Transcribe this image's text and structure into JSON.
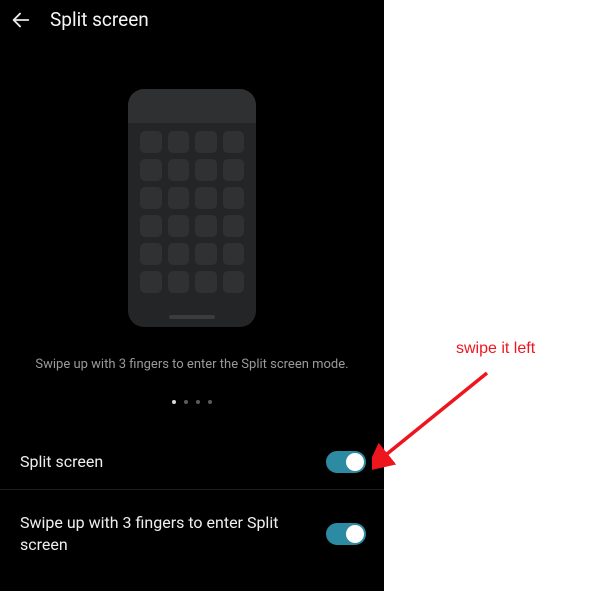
{
  "header": {
    "title": "Split screen"
  },
  "hint": "Swipe up with 3 fingers to enter the Split screen mode.",
  "pager": {
    "count": 4,
    "active": 0
  },
  "settings": {
    "row1_label": "Split screen",
    "row1_on": true,
    "row2_label": "Swipe up with 3 fingers to enter Split screen",
    "row2_on": true
  },
  "colors": {
    "toggle_on": "#2d8aa3",
    "annotation": "#ee161e"
  },
  "annotation": {
    "text": "swipe it left"
  }
}
